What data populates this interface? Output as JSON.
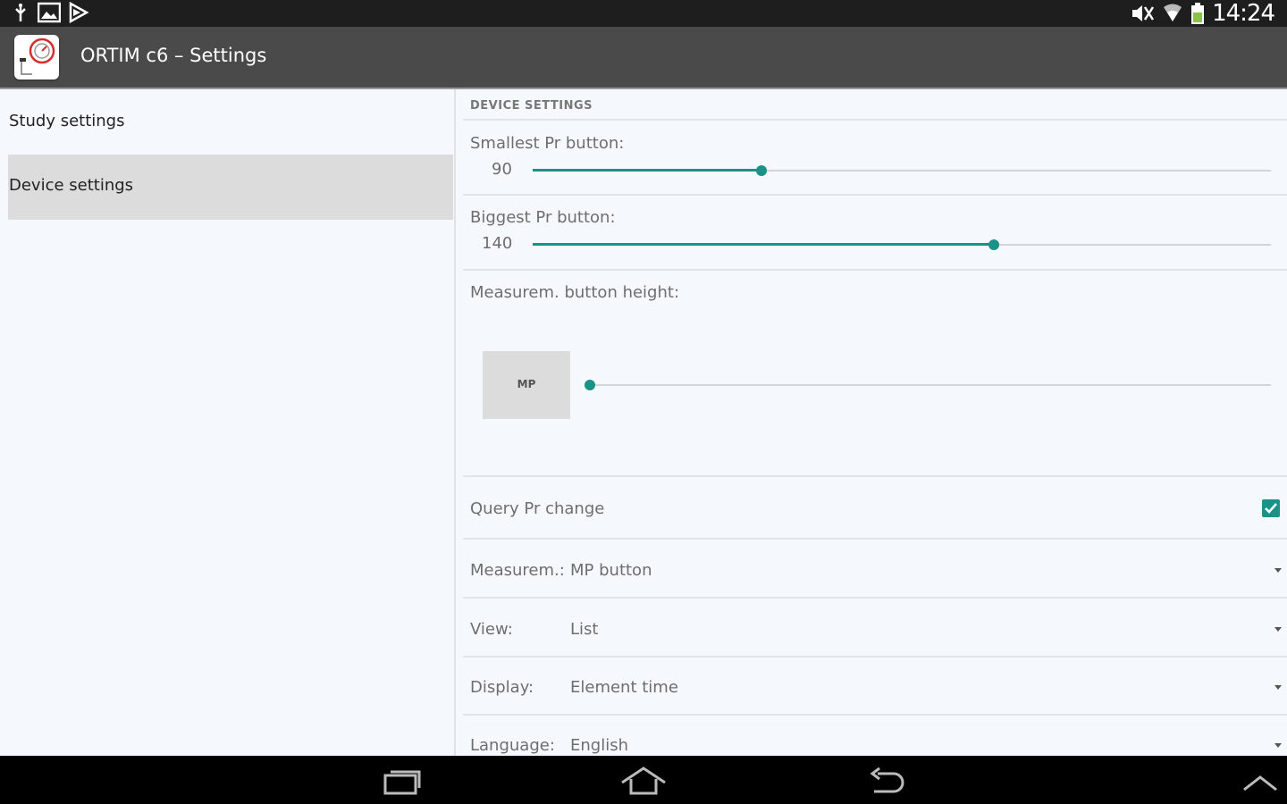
{
  "status_bar": {
    "time": "14:24",
    "left_icons": [
      "usb-icon",
      "gallery-icon",
      "play-store-icon"
    ],
    "right_icons": [
      "mute-icon",
      "wifi-icon",
      "battery-icon"
    ]
  },
  "action_bar": {
    "title": "ORTIM c6 – Settings",
    "icon": "app-logo-icon"
  },
  "headers": [
    {
      "label": "Study settings",
      "selected": false
    },
    {
      "label": "Device settings",
      "selected": true
    }
  ],
  "device_settings": {
    "section_title": "DEVICE SETTINGS",
    "smallest_pr": {
      "label": "Smallest Pr button:",
      "value": "90",
      "fraction": 0.31
    },
    "biggest_pr": {
      "label": "Biggest Pr button:",
      "value": "140",
      "fraction": 0.625
    },
    "measure_height": {
      "label": "Measurem. button height:",
      "button_label": "MP",
      "fraction": 0.0
    },
    "query_pr": {
      "label": "Query Pr change",
      "checked": true
    },
    "measure_mode": {
      "label": "Measurem.:",
      "value": "MP button"
    },
    "view": {
      "label": "View:",
      "value": "List"
    },
    "display": {
      "label": "Display:",
      "value": "Element time"
    },
    "language": {
      "label": "Language:",
      "value": "English"
    }
  },
  "colors": {
    "accent": "#1a9288",
    "status_bar": "#1e1e1e",
    "action_bar": "#4a4a4a",
    "selected_header": "#dcdcdc"
  },
  "nav_bar": {
    "buttons": [
      "recent-apps-icon",
      "home-icon",
      "back-icon",
      "chevron-up-icon"
    ]
  }
}
